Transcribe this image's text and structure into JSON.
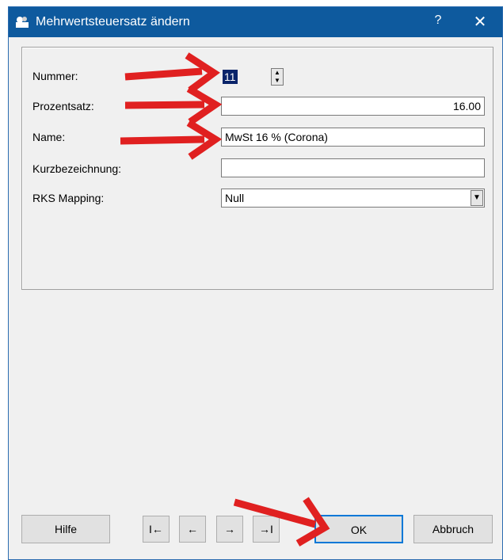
{
  "window": {
    "title": "Mehrwertsteuersatz ändern",
    "help_glyph": "?",
    "close_glyph": "✕"
  },
  "form": {
    "nummer_label": "Nummer:",
    "nummer_value": "11",
    "prozentsatz_label": "Prozentsatz:",
    "prozentsatz_value": "16.00",
    "name_label": "Name:",
    "name_value": "MwSt 16  % (Corona)",
    "kurz_label": "Kurzbezeichnung:",
    "kurz_value": "",
    "rks_label": "RKS Mapping:",
    "rks_value": "Null"
  },
  "buttons": {
    "hilfe": "Hilfe",
    "first": "I←",
    "prev": "←",
    "next": "→",
    "last": "→I",
    "ok": "OK",
    "abbruch": "Abbruch"
  },
  "colors": {
    "titlebar": "#0e5a9e",
    "annotation_arrow": "#e02020"
  },
  "icons": {
    "app": "app-icon",
    "help": "help-icon",
    "close": "close-icon"
  }
}
